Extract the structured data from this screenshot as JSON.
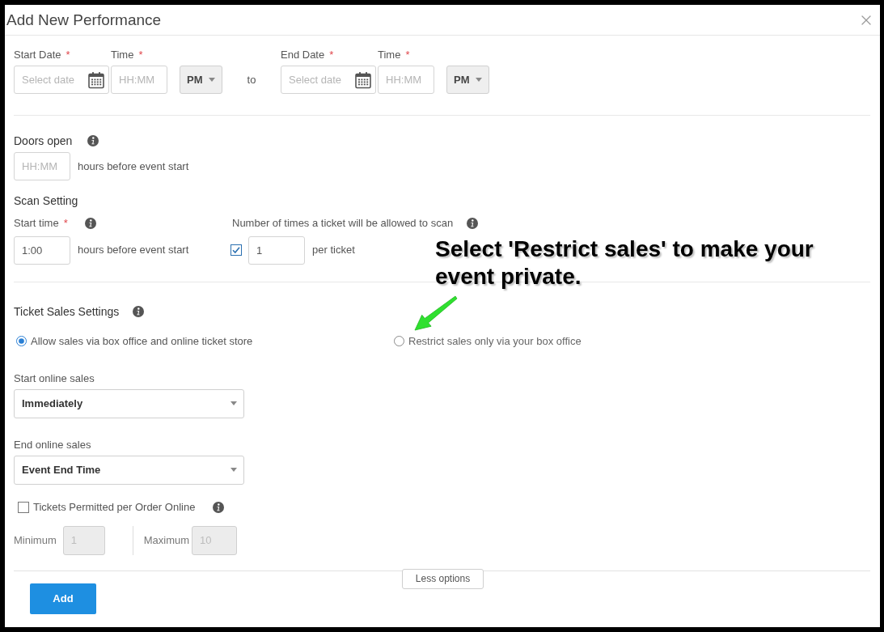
{
  "dialog": {
    "title": "Add New Performance"
  },
  "schedule": {
    "start_date": {
      "label": "Start Date",
      "mark": "*",
      "placeholder": "Select date"
    },
    "start_time": {
      "label": "Time",
      "mark": "*",
      "placeholder": "HH:MM"
    },
    "start_period": {
      "value": "PM"
    },
    "separator": "to",
    "end_date": {
      "label": "End Date",
      "mark": "*",
      "placeholder": "Select date"
    },
    "end_time": {
      "label": "Time",
      "mark": "*",
      "placeholder": "HH:MM"
    },
    "end_period": {
      "value": "PM"
    }
  },
  "doors_open": {
    "heading": "Doors open",
    "placeholder": "HH:MM",
    "suffix": "hours before event start"
  },
  "scan_setting": {
    "heading": "Scan Setting",
    "start_time": {
      "label": "Start time",
      "mark": "*",
      "value": "1:00",
      "suffix": "hours before event start"
    },
    "scan_limit": {
      "label": "Number of times a ticket will be allowed to scan",
      "checked": true,
      "value": "1",
      "suffix": "per ticket"
    }
  },
  "ticket_sales": {
    "heading": "Ticket Sales Settings",
    "options": [
      {
        "label": "Allow sales via box office and online ticket store",
        "selected": true
      },
      {
        "label": "Restrict sales only via your box office",
        "selected": false
      }
    ],
    "start_online_sales": {
      "label": "Start online sales",
      "value": "Immediately"
    },
    "end_online_sales": {
      "label": "End online sales",
      "value": "Event End Time"
    },
    "order_limit": {
      "label": "Tickets Permitted per Order Online",
      "checked": false,
      "minimum": {
        "label": "Minimum",
        "placeholder": "1",
        "disabled": true
      },
      "maximum": {
        "label": "Maximum",
        "placeholder": "10",
        "disabled": true
      }
    }
  },
  "footer": {
    "toggle_button": "Less options",
    "submit_button": "Add"
  },
  "callout": {
    "text": "Select 'Restrict sales' to make your event private."
  }
}
